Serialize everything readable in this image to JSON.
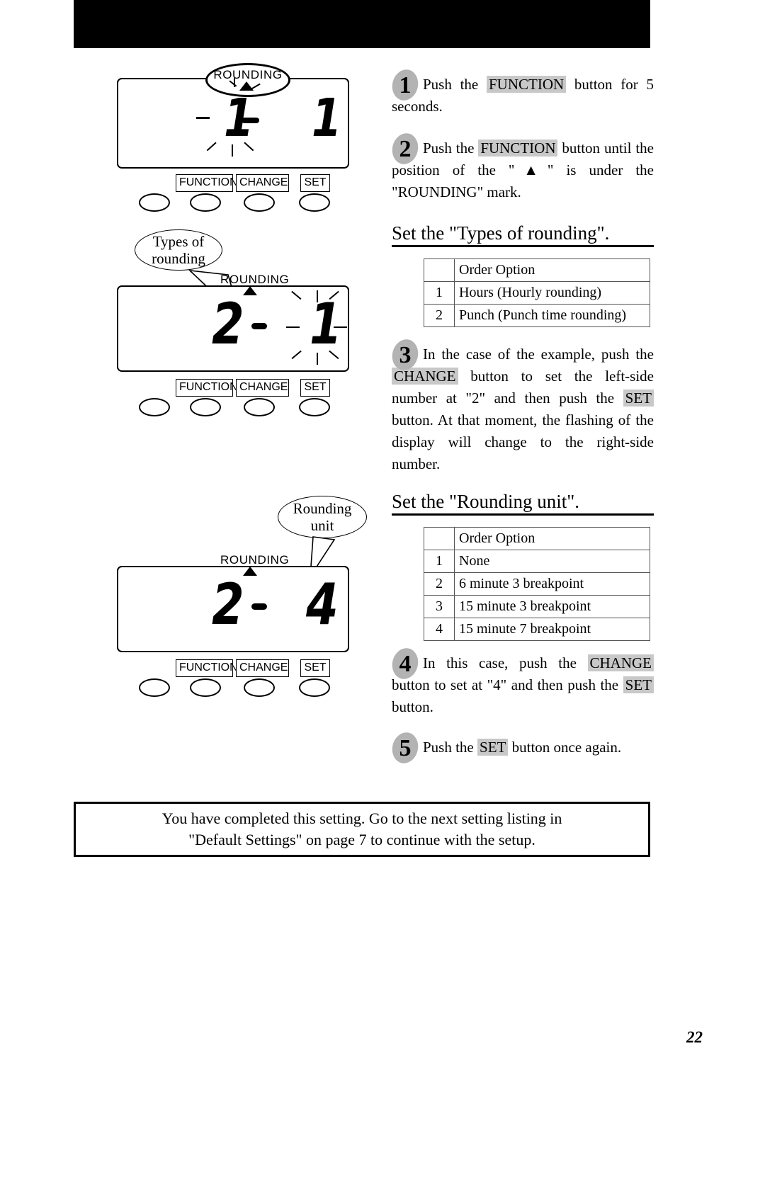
{
  "page": {
    "number": "22",
    "banner_color": "#000000"
  },
  "device_panels": [
    {
      "id": "panel-1",
      "indicator_label": "ROUNDING",
      "indicator_style": "oval-callout",
      "left_digit": "1",
      "left_digit_flashing": true,
      "separator": "-",
      "right_digit": "1",
      "right_digit_flashing": false,
      "buttons": [
        "",
        "FUNCTION",
        "CHANGE",
        "SET"
      ]
    },
    {
      "id": "panel-2",
      "indicator_label": "ROUNDING",
      "indicator_style": "plain",
      "callout": "Types of\nrounding",
      "callout_line1": "Types of",
      "callout_line2": "rounding",
      "left_digit": "2",
      "left_digit_flashing": false,
      "separator": "-",
      "right_digit": "1",
      "right_digit_flashing": true,
      "buttons": [
        "",
        "FUNCTION",
        "CHANGE",
        "SET"
      ]
    },
    {
      "id": "panel-3",
      "indicator_label": "ROUNDING",
      "indicator_style": "plain",
      "callout_line1": "Rounding",
      "callout_line2": "unit",
      "left_digit": "2",
      "left_digit_flashing": false,
      "separator": "-",
      "right_digit": "4",
      "right_digit_flashing": false,
      "buttons": [
        "",
        "FUNCTION",
        "CHANGE",
        "SET"
      ]
    }
  ],
  "steps": {
    "step1": {
      "number": "1",
      "part1": "Push the ",
      "kbd1": "FUNCTION",
      "part2": " button for 5 seconds."
    },
    "step2": {
      "number": "2",
      "part1": "Push the ",
      "kbd1": "FUNCTION",
      "part2": " button until the position of the \"▲\" is under the \"ROUNDING\" mark."
    },
    "step3": {
      "number": "3",
      "part1": "In the case of the example, push the ",
      "kbd1": "CHANGE",
      "part2": " button to set the left-side number at \"2\" and then push the ",
      "kbd2": "SET",
      "part3": " button. At that moment, the flashing of the display will change to the right-side number."
    },
    "step4": {
      "number": "4",
      "part1": "In this case, push the ",
      "kbd1": "CHANGE",
      "part2": " button to set at \"4\" and then push the ",
      "kbd2": "SET",
      "part3": " button."
    },
    "step5": {
      "number": "5",
      "part1": "Push the ",
      "kbd1": "SET",
      "part2": " button once again."
    }
  },
  "sections": {
    "types_of_rounding": {
      "heading": "Set the \"Types of rounding\".",
      "table": {
        "header": {
          "num": "",
          "option": "Order Option"
        },
        "rows": [
          {
            "num": "1",
            "option": "Hours (Hourly rounding)"
          },
          {
            "num": "2",
            "option": "Punch (Punch time rounding)"
          }
        ]
      }
    },
    "rounding_unit": {
      "heading": "Set the \"Rounding unit\".",
      "table": {
        "header": {
          "num": "",
          "option": "Order Option"
        },
        "rows": [
          {
            "num": "1",
            "option": "None"
          },
          {
            "num": "2",
            "option": "6 minute 3 breakpoint"
          },
          {
            "num": "3",
            "option": "15 minute 3 breakpoint"
          },
          {
            "num": "4",
            "option": "15 minute 7 breakpoint"
          }
        ]
      }
    }
  },
  "notice": {
    "line1": "You have completed this setting.  Go to the next setting listing in",
    "line2": "\"Default Settings\" on page 7 to continue with the setup."
  }
}
